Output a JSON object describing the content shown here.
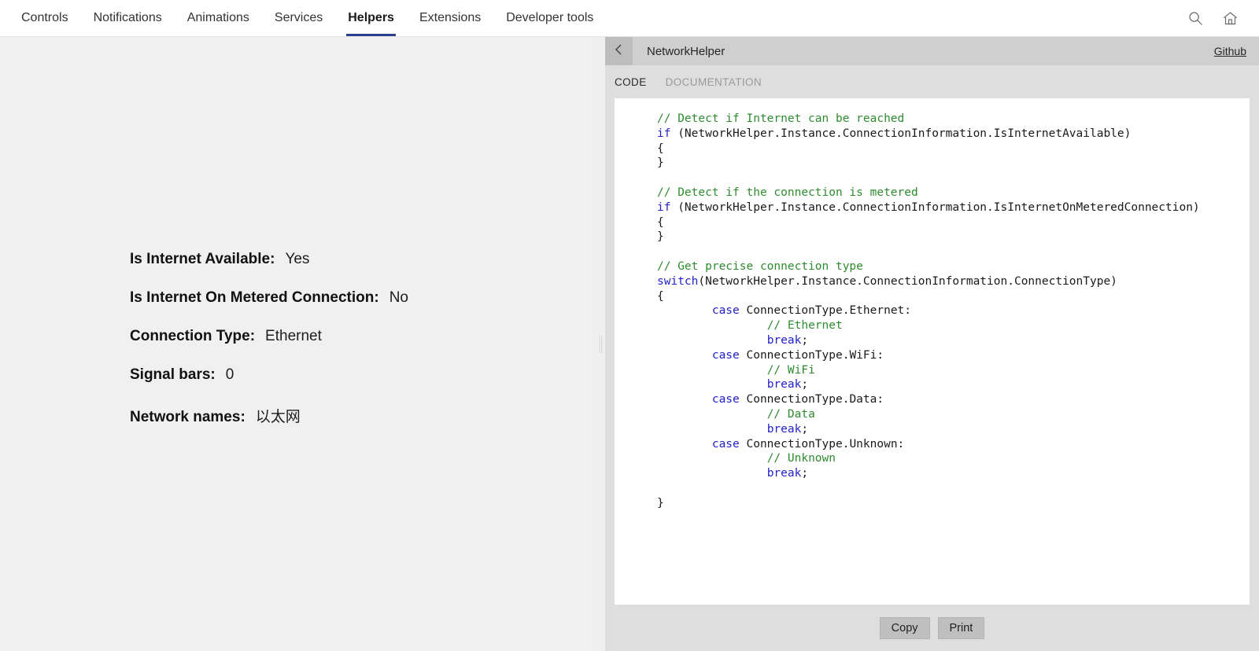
{
  "top_nav": {
    "tabs": [
      {
        "label": "Controls",
        "active": false
      },
      {
        "label": "Notifications",
        "active": false
      },
      {
        "label": "Animations",
        "active": false
      },
      {
        "label": "Services",
        "active": false
      },
      {
        "label": "Helpers",
        "active": true
      },
      {
        "label": "Extensions",
        "active": false
      },
      {
        "label": "Developer tools",
        "active": false
      }
    ],
    "actions": [
      {
        "icon": "search-icon"
      },
      {
        "icon": "home-icon"
      }
    ],
    "active_underline_color": "#2b3f8c"
  },
  "left_panel": {
    "properties": [
      {
        "label": "Is Internet Available:",
        "value": "Yes"
      },
      {
        "label": "Is Internet On Metered Connection:",
        "value": "No"
      },
      {
        "label": "Connection Type:",
        "value": "Ethernet"
      },
      {
        "label": "Signal bars:",
        "value": "0"
      },
      {
        "label": "Network names:",
        "value": "以太网"
      }
    ]
  },
  "right_panel": {
    "back_icon": "chevron-left-icon",
    "title": "NetworkHelper",
    "github_label": "Github",
    "tabs": [
      {
        "label": "CODE",
        "active": true
      },
      {
        "label": "DOCUMENTATION",
        "active": false
      }
    ],
    "code_lines": [
      {
        "indent": 0,
        "parts": [
          {
            "t": "comment",
            "s": "// Detect if Internet can be reached"
          }
        ]
      },
      {
        "indent": 0,
        "parts": [
          {
            "t": "keyword",
            "s": "if"
          },
          {
            "t": "plain",
            "s": " (NetworkHelper.Instance.ConnectionInformation.IsInternetAvailable)"
          }
        ]
      },
      {
        "indent": 0,
        "parts": [
          {
            "t": "plain",
            "s": "{"
          }
        ]
      },
      {
        "indent": 0,
        "parts": [
          {
            "t": "plain",
            "s": "}"
          }
        ]
      },
      {
        "indent": 0,
        "parts": [
          {
            "t": "plain",
            "s": ""
          }
        ]
      },
      {
        "indent": 0,
        "parts": [
          {
            "t": "comment",
            "s": "// Detect if the connection is metered"
          }
        ]
      },
      {
        "indent": 0,
        "parts": [
          {
            "t": "keyword",
            "s": "if"
          },
          {
            "t": "plain",
            "s": " (NetworkHelper.Instance.ConnectionInformation.IsInternetOnMeteredConnection)"
          }
        ]
      },
      {
        "indent": 0,
        "parts": [
          {
            "t": "plain",
            "s": "{"
          }
        ]
      },
      {
        "indent": 0,
        "parts": [
          {
            "t": "plain",
            "s": "}"
          }
        ]
      },
      {
        "indent": 0,
        "parts": [
          {
            "t": "plain",
            "s": ""
          }
        ]
      },
      {
        "indent": 0,
        "parts": [
          {
            "t": "comment",
            "s": "// Get precise connection type"
          }
        ]
      },
      {
        "indent": 0,
        "parts": [
          {
            "t": "keyword",
            "s": "switch"
          },
          {
            "t": "plain",
            "s": "(NetworkHelper.Instance.ConnectionInformation.ConnectionType)"
          }
        ]
      },
      {
        "indent": 0,
        "parts": [
          {
            "t": "plain",
            "s": "{"
          }
        ]
      },
      {
        "indent": 0,
        "parts": [
          {
            "t": "plain",
            "s": "        "
          },
          {
            "t": "keyword",
            "s": "case"
          },
          {
            "t": "plain",
            "s": " ConnectionType.Ethernet:"
          }
        ]
      },
      {
        "indent": 0,
        "parts": [
          {
            "t": "plain",
            "s": "                "
          },
          {
            "t": "comment",
            "s": "// Ethernet"
          }
        ]
      },
      {
        "indent": 0,
        "parts": [
          {
            "t": "plain",
            "s": "                "
          },
          {
            "t": "keyword",
            "s": "break"
          },
          {
            "t": "plain",
            "s": ";"
          }
        ]
      },
      {
        "indent": 0,
        "parts": [
          {
            "t": "plain",
            "s": "        "
          },
          {
            "t": "keyword",
            "s": "case"
          },
          {
            "t": "plain",
            "s": " ConnectionType.WiFi:"
          }
        ]
      },
      {
        "indent": 0,
        "parts": [
          {
            "t": "plain",
            "s": "                "
          },
          {
            "t": "comment",
            "s": "// WiFi"
          }
        ]
      },
      {
        "indent": 0,
        "parts": [
          {
            "t": "plain",
            "s": "                "
          },
          {
            "t": "keyword",
            "s": "break"
          },
          {
            "t": "plain",
            "s": ";"
          }
        ]
      },
      {
        "indent": 0,
        "parts": [
          {
            "t": "plain",
            "s": "        "
          },
          {
            "t": "keyword",
            "s": "case"
          },
          {
            "t": "plain",
            "s": " ConnectionType.Data:"
          }
        ]
      },
      {
        "indent": 0,
        "parts": [
          {
            "t": "plain",
            "s": "                "
          },
          {
            "t": "comment",
            "s": "// Data"
          }
        ]
      },
      {
        "indent": 0,
        "parts": [
          {
            "t": "plain",
            "s": "                "
          },
          {
            "t": "keyword",
            "s": "break"
          },
          {
            "t": "plain",
            "s": ";"
          }
        ]
      },
      {
        "indent": 0,
        "parts": [
          {
            "t": "plain",
            "s": "        "
          },
          {
            "t": "keyword",
            "s": "case"
          },
          {
            "t": "plain",
            "s": " ConnectionType.Unknown:"
          }
        ]
      },
      {
        "indent": 0,
        "parts": [
          {
            "t": "plain",
            "s": "                "
          },
          {
            "t": "comment",
            "s": "// Unknown"
          }
        ]
      },
      {
        "indent": 0,
        "parts": [
          {
            "t": "plain",
            "s": "                "
          },
          {
            "t": "keyword",
            "s": "break"
          },
          {
            "t": "plain",
            "s": ";"
          }
        ]
      },
      {
        "indent": 0,
        "parts": [
          {
            "t": "plain",
            "s": ""
          }
        ]
      },
      {
        "indent": 0,
        "parts": [
          {
            "t": "plain",
            "s": "}"
          }
        ]
      }
    ],
    "buttons": [
      {
        "label": "Copy"
      },
      {
        "label": "Print"
      }
    ],
    "syntax_colors": {
      "comment": "#2e8b2e",
      "keyword": "#2222cc",
      "plain": "#1a1a1a"
    }
  }
}
